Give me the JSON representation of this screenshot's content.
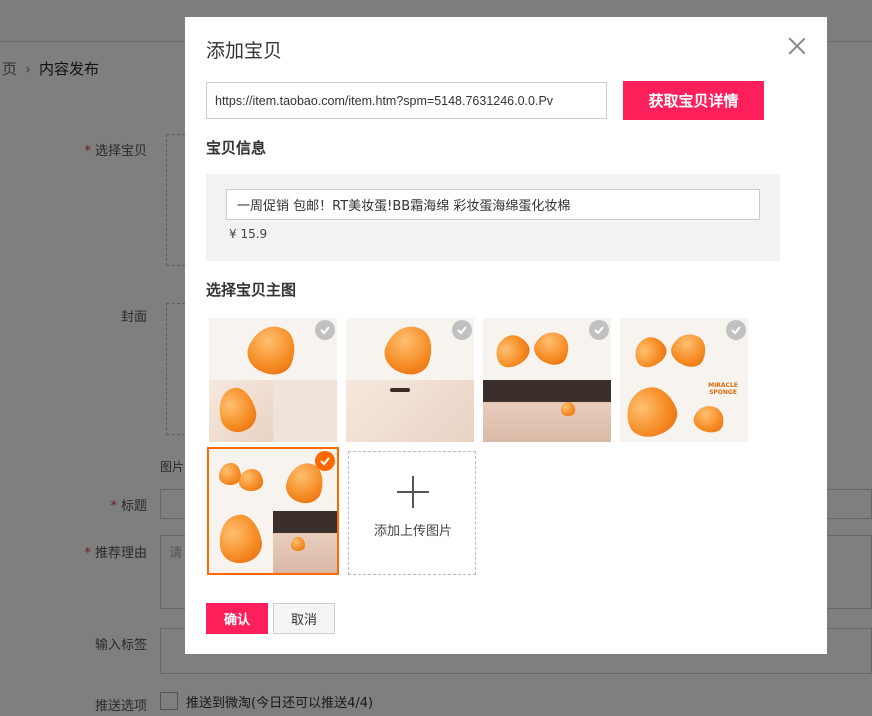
{
  "background": {
    "breadcrumb": {
      "prev": "页",
      "separator": "›",
      "current": "内容发布"
    },
    "labels": {
      "select_item": "选择宝贝",
      "cover": "封面",
      "image_note": "图片",
      "title": "标题",
      "reason": "推荐理由",
      "tags": "输入标签",
      "push_options": "推送选项"
    },
    "reason_placeholder": "请",
    "push_checkbox_label": "推送到微淘(今日还可以推送4/4)"
  },
  "modal": {
    "title": "添加宝贝",
    "url_value": "https://item.taobao.com/item.htm?spm=5148.7631246.0.0.Pv",
    "fetch_button": "获取宝贝详情",
    "info_section_title": "宝贝信息",
    "item_title": "一周促销 包邮！RT美妆蛋!BB霜海绵 彩妆蛋海绵蛋化妆棉",
    "item_price": "¥ 15.9",
    "images_section_title": "选择宝贝主图",
    "thumbnails": [
      {
        "name": "sponge-photo-1",
        "checked": false
      },
      {
        "name": "sponge-photo-2",
        "checked": false
      },
      {
        "name": "sponge-photo-3",
        "checked": false
      },
      {
        "name": "sponge-photo-4",
        "checked": false
      },
      {
        "name": "sponge-photo-5",
        "checked": true
      }
    ],
    "badge_text": "MIRACLE SPONGE",
    "upload_label": "添加上传图片",
    "confirm_button": "确认",
    "cancel_button": "取消"
  },
  "colors": {
    "primary": "#ff1f5a",
    "selected_border": "#ff6a00",
    "required_star": "#e4393c"
  }
}
